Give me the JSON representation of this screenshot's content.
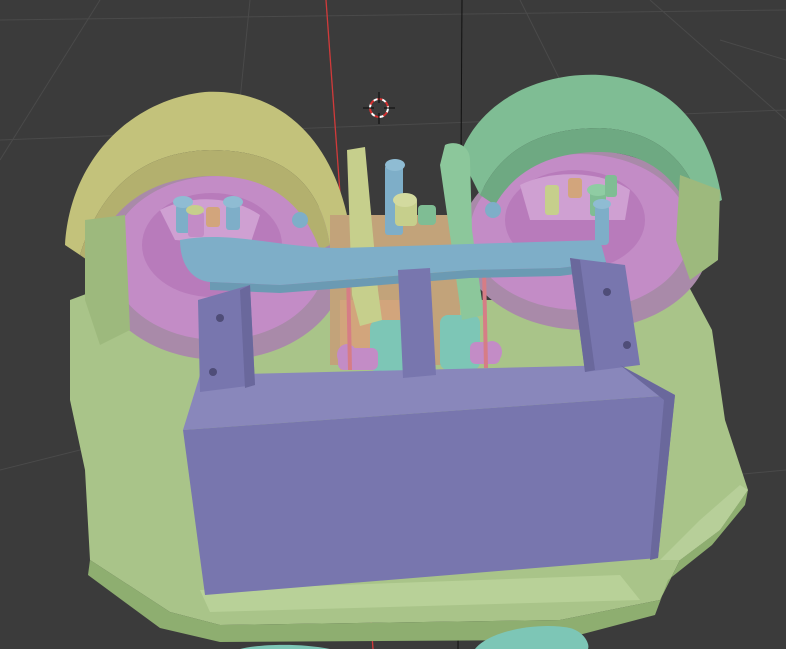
{
  "viewport": {
    "background": "#3b3b3b",
    "grid_color": "#4a4a4a",
    "x_axis_color": "#d23a3a",
    "z_axis_color": "#111111",
    "cursor_icon": "3d-cursor-icon"
  },
  "model": {
    "base_color": "#a9c489",
    "box_color": "#7876ae",
    "bell_left_color": "#c3c27b",
    "bell_right_color": "#7fbd94",
    "inner_color": "#c38cc6",
    "arm_color": "#7eaec8",
    "lever_color": "#c6cf8c",
    "pink_color": "#d67d86",
    "mint_color": "#7dc6b6",
    "peach_color": "#d2a57c"
  }
}
